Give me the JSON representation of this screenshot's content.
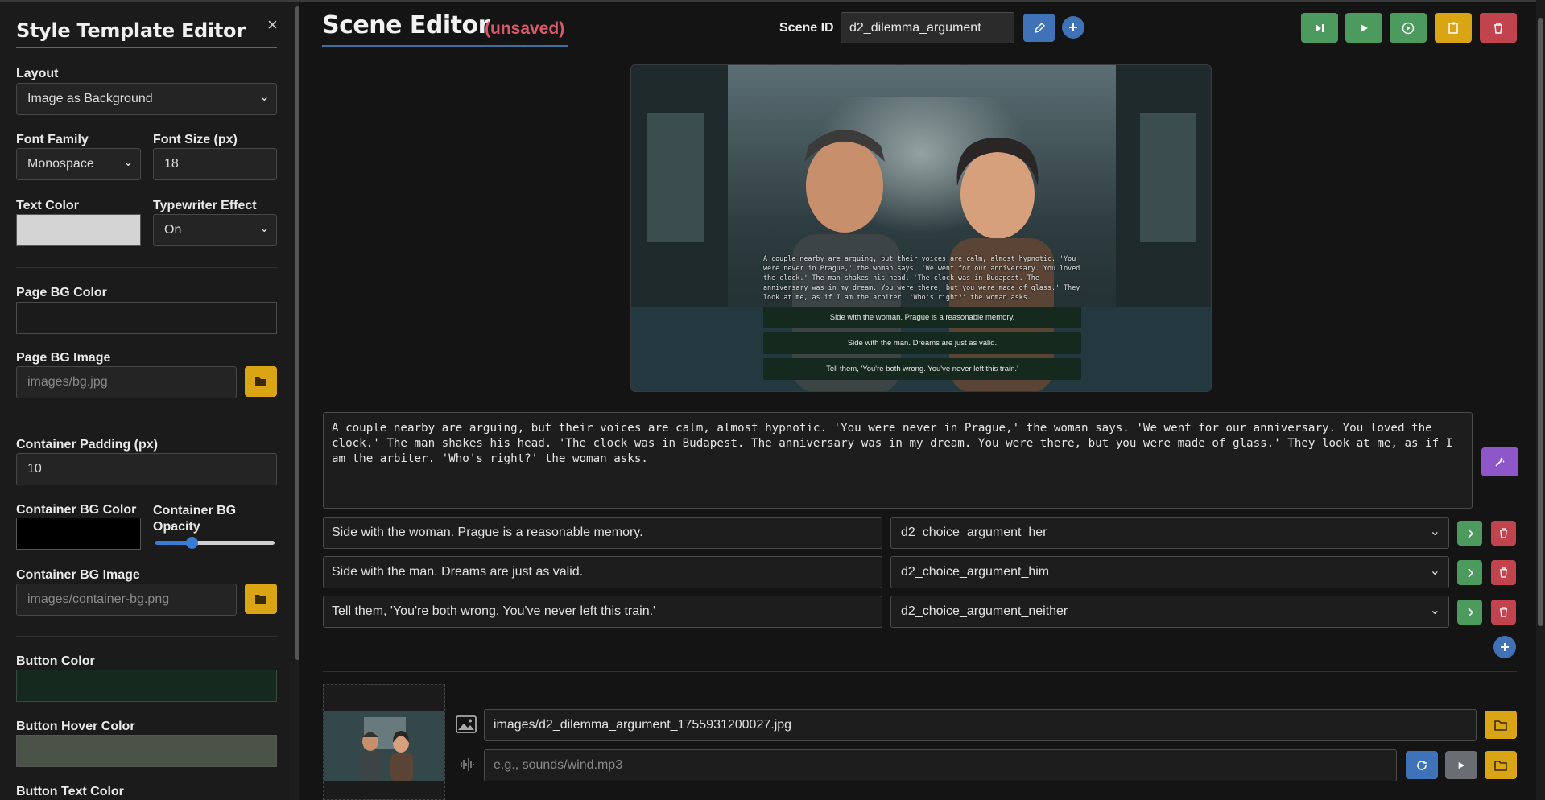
{
  "sidebar": {
    "title": "Style Template Editor",
    "close_glyph": "×",
    "layout_label": "Layout",
    "layout_value": "Image as Background",
    "font_family_label": "Font Family",
    "font_family_value": "Monospace",
    "font_size_label": "Font Size (px)",
    "font_size_value": "18",
    "text_color_label": "Text Color",
    "text_color_value": "#d4d4d4",
    "typewriter_label": "Typewriter Effect",
    "typewriter_value": "On",
    "page_bg_color_label": "Page BG Color",
    "page_bg_color_value": "#1b1b1b",
    "page_bg_image_label": "Page BG Image",
    "page_bg_image_placeholder": "images/bg.jpg",
    "container_padding_label": "Container Padding (px)",
    "container_padding_value": "10",
    "container_bg_color_label": "Container BG Color",
    "container_bg_color_value": "#000000",
    "container_bg_opacity_label": "Container BG Opacity",
    "container_bg_opacity_value": 0.3,
    "container_bg_image_label": "Container BG Image",
    "container_bg_image_placeholder": "images/container-bg.png",
    "button_color_label": "Button Color",
    "button_color_value": "#16291f",
    "button_hover_label": "Button Hover Color",
    "button_hover_value": "#4a5248",
    "button_text_label": "Button Text Color"
  },
  "header": {
    "title": "Scene Editor",
    "unsaved": "(unsaved)",
    "scene_id_label": "Scene ID",
    "scene_id_value": "d2_dilemma_argument"
  },
  "preview": {
    "text": "A couple nearby are arguing, but their voices are calm, almost hypnotic. 'You were never in Prague,' the woman says. 'We went for our anniversary. You loved the clock.' The man shakes his head. 'The clock was in Budapest. The anniversary was in my dream. You were there, but you were made of glass.' They look at me, as if I am the arbiter. 'Who's right?' the woman asks.",
    "choices": [
      "Side with the woman. Prague is a reasonable memory.",
      "Side with the man. Dreams are just as valid.",
      "Tell them, 'You're both wrong. You've never left this train.'"
    ]
  },
  "editor": {
    "text": "A couple nearby are arguing, but their voices are calm, almost hypnotic. 'You were never in Prague,' the woman says. 'We went for our anniversary. You loved the clock.' The man shakes his head. 'The clock was in Budapest. The anniversary was in my dream. You were there, but you were made of glass.' They look at me, as if I am the arbiter. 'Who's right?' the woman asks.",
    "choices": [
      {
        "text": "Side with the woman. Prague is a reasonable memory.",
        "target": "d2_choice_argument_her"
      },
      {
        "text": "Side with the man. Dreams are just as valid.",
        "target": "d2_choice_argument_him"
      },
      {
        "text": "Tell them, 'You're both wrong. You've never left this train.'",
        "target": "d2_choice_argument_neither"
      }
    ]
  },
  "media": {
    "image_path": "images/d2_dilemma_argument_1755931200027.jpg",
    "sound_placeholder": "e.g., sounds/wind.mp3"
  },
  "colors": {
    "accent": "#3f6ea3",
    "green": "#4c9a5e",
    "amber": "#d9a514",
    "red": "#c0434e",
    "blue": "#3f72b7",
    "purple": "#8e57c9",
    "unsaved": "#d9596b"
  }
}
